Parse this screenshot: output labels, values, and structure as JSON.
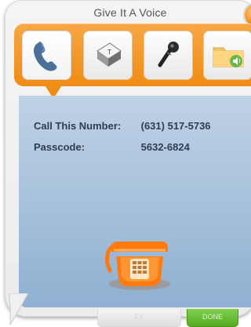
{
  "window": {
    "title": "Give It A Voice"
  },
  "toolbar": {
    "tools": [
      {
        "icon": "telephone-handset-icon",
        "active": true
      },
      {
        "icon": "keyboard-key-icon",
        "key_label": "T"
      },
      {
        "icon": "microphone-icon"
      },
      {
        "icon": "folder-audio-icon"
      }
    ]
  },
  "call_info": {
    "number_label": "Call This Number:",
    "number_value": "(631) 517-5736",
    "passcode_label": "Passcode:",
    "passcode_value": "5632-6824"
  },
  "footer": {
    "fx_label": "FX",
    "done_label": "DONE"
  },
  "colors": {
    "accent_orange": "#ef8c14",
    "panel_blue": "#a9c3dc",
    "done_green": "#59b22a"
  }
}
